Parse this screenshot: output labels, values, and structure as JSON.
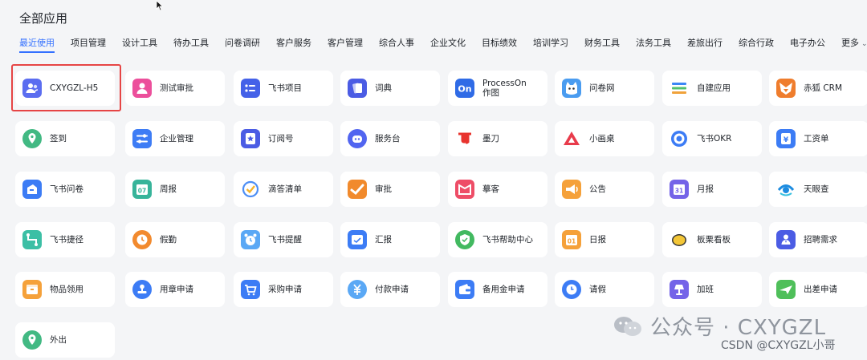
{
  "title": "全部应用",
  "tabs": [
    {
      "label": "最近使用",
      "active": true
    },
    {
      "label": "项目管理"
    },
    {
      "label": "设计工具"
    },
    {
      "label": "待办工具"
    },
    {
      "label": "问卷调研"
    },
    {
      "label": "客户服务"
    },
    {
      "label": "客户管理"
    },
    {
      "label": "综合人事"
    },
    {
      "label": "企业文化"
    },
    {
      "label": "目标绩效"
    },
    {
      "label": "培训学习"
    },
    {
      "label": "财务工具"
    },
    {
      "label": "法务工具"
    },
    {
      "label": "差旅出行"
    },
    {
      "label": "综合行政"
    },
    {
      "label": "电子办公"
    },
    {
      "label": "更多"
    }
  ],
  "apps": [
    {
      "label": "CXYGZL-H5",
      "icon": "users-icon",
      "color": "#5b6df0"
    },
    {
      "label": "测试审批",
      "icon": "person-icon",
      "color": "#ec4f9b"
    },
    {
      "label": "飞书项目",
      "icon": "list-icon",
      "color": "#4461e8"
    },
    {
      "label": "词典",
      "icon": "cards-icon",
      "color": "#4b5ce4"
    },
    {
      "label": "ProcessOn作图",
      "icon": "processon-icon",
      "color": "#2f6be6",
      "glyph": "On"
    },
    {
      "label": "问卷网",
      "icon": "cat-icon",
      "color": "#4a9cf0"
    },
    {
      "label": "自建应用",
      "icon": "bars-icon",
      "color": "#ffffff"
    },
    {
      "label": "赤狐 CRM",
      "icon": "fox-icon",
      "color": "#ef7d2d"
    },
    {
      "label": "签到",
      "icon": "location-icon",
      "color": "#42b983"
    },
    {
      "label": "企业管理",
      "icon": "toggle-icon",
      "color": "#3d7cf5"
    },
    {
      "label": "订阅号",
      "icon": "star-icon",
      "color": "#4b5ce4"
    },
    {
      "label": "服务台",
      "icon": "robot-icon",
      "color": "#5165f0"
    },
    {
      "label": "墨刀",
      "icon": "modao-icon",
      "color": "#ffffff"
    },
    {
      "label": "小画桌",
      "icon": "triangle-icon",
      "color": "#ffffff"
    },
    {
      "label": "飞书OKR",
      "icon": "target-icon",
      "color": "#ffffff"
    },
    {
      "label": "工资单",
      "icon": "yen-icon",
      "color": "#3c7cf5"
    },
    {
      "label": "飞书问卷",
      "icon": "form-icon",
      "color": "#3c7cf5"
    },
    {
      "label": "周报",
      "icon": "calendar-icon",
      "color": "#37b49a",
      "glyph": "07"
    },
    {
      "label": "滴答清单",
      "icon": "check-icon",
      "color": "#ffffff"
    },
    {
      "label": "审批",
      "icon": "approve-icon",
      "color": "#f18a2c"
    },
    {
      "label": "摹客",
      "icon": "mockplus-icon",
      "color": "#ee4d67"
    },
    {
      "label": "公告",
      "icon": "megaphone-icon",
      "color": "#f5a13a"
    },
    {
      "label": "月报",
      "icon": "calendar-icon",
      "color": "#7463e8",
      "glyph": "31"
    },
    {
      "label": "天眼查",
      "icon": "eye-icon",
      "color": "#ffffff"
    },
    {
      "label": "飞书捷径",
      "icon": "flow-icon",
      "color": "#3cbfa5"
    },
    {
      "label": "假勤",
      "icon": "clock-icon",
      "color": "#f28a2e"
    },
    {
      "label": "飞书提醒",
      "icon": "alarm-icon",
      "color": "#5aa8f5"
    },
    {
      "label": "汇报",
      "icon": "report-icon",
      "color": "#3c7cf5"
    },
    {
      "label": "飞书帮助中心",
      "icon": "shield-icon",
      "color": "#42b960"
    },
    {
      "label": "日报",
      "icon": "calendar-icon",
      "color": "#f5a13a",
      "glyph": "01"
    },
    {
      "label": "板栗看板",
      "icon": "chestnut-icon",
      "color": "#ffffff"
    },
    {
      "label": "招聘需求",
      "icon": "recruit-icon",
      "color": "#4b5ce4"
    },
    {
      "label": "物品领用",
      "icon": "box-icon",
      "color": "#f5a13a"
    },
    {
      "label": "用章申请",
      "icon": "stamp-icon",
      "color": "#3c7cf5"
    },
    {
      "label": "采购申请",
      "icon": "cart-icon",
      "color": "#3c7cf5"
    },
    {
      "label": "付款申请",
      "icon": "payment-icon",
      "color": "#5aa8f5"
    },
    {
      "label": "备用金申请",
      "icon": "wallet-icon",
      "color": "#3c7cf5"
    },
    {
      "label": "请假",
      "icon": "leave-icon",
      "color": "#3c7cf5"
    },
    {
      "label": "加班",
      "icon": "lamp-icon",
      "color": "#7463e8"
    },
    {
      "label": "出差申请",
      "icon": "plane-icon",
      "color": "#4fbf5a"
    },
    {
      "label": "外出",
      "icon": "pin-icon",
      "color": "#42b983"
    }
  ],
  "watermark": {
    "text": "公众号 · CXYGZL"
  },
  "credit": "CSDN @CXYGZL小哥"
}
